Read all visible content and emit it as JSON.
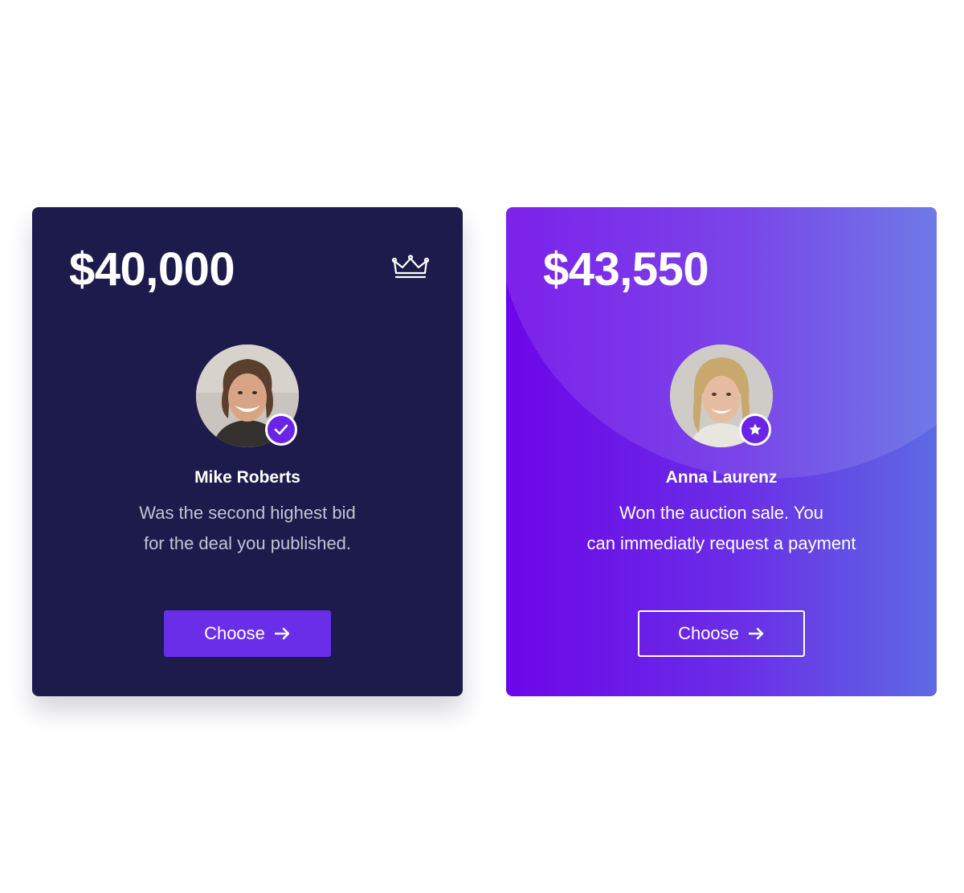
{
  "cards": [
    {
      "price": "$40,000",
      "name": "Mike Roberts",
      "description": [
        "Was the second highest bid",
        "for the deal you published."
      ],
      "button_label": "Choose",
      "badge_icon": "check-icon",
      "corner_icon": "crown-icon"
    },
    {
      "price": "$43,550",
      "name": "Anna Laurenz",
      "description": [
        "Won the auction sale. You",
        "can immediatly request a payment"
      ],
      "button_label": "Choose",
      "badge_icon": "star-icon"
    }
  ],
  "colors": {
    "dark_card": "#1c1b4b",
    "purple_start": "#6c06e8",
    "purple_end": "#5d6ae3",
    "accent": "#6a2ee9"
  }
}
